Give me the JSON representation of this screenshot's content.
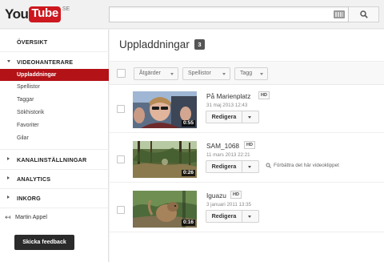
{
  "header": {
    "logo_you": "You",
    "logo_tube": "Tube",
    "logo_region": "SE",
    "search": {
      "value": "",
      "placeholder": ""
    }
  },
  "sidebar": {
    "overview": "ÖVERSIKT",
    "video_manager": "VIDEOHANTERARE",
    "sub_items": [
      "Uppladdningar",
      "Spellistor",
      "Taggar",
      "Sökhistorik",
      "Favoriter",
      "Gilar"
    ],
    "active_item": "Uppladdningar",
    "channel_settings": "KANALINSTÄLLNINGAR",
    "analytics": "ANALYTICS",
    "inbox": "INKORG",
    "user_name": "Martin Appel",
    "feedback_button": "Skicka feedback"
  },
  "main": {
    "title": "Uppladdningar",
    "count": "3",
    "toolbar": {
      "actions": "Åtgärder",
      "playlists": "Spellistor",
      "tags": "Tagg"
    },
    "videos": [
      {
        "title": "På Marienplatz",
        "hd": "HD",
        "date": "31 maj 2013 12:43",
        "duration": "0:55",
        "edit_label": "Redigera",
        "tip": ""
      },
      {
        "title": "SAM_1068",
        "hd": "HD",
        "date": "11 mars 2013 22:21",
        "duration": "0:26",
        "edit_label": "Redigera",
        "tip": "Förbättra det här videoklippet"
      },
      {
        "title": "Iguazu",
        "hd": "HD",
        "date": "3 januari 2011 13:35",
        "duration": "0:16",
        "edit_label": "Redigera",
        "tip": ""
      }
    ]
  },
  "colors": {
    "brand_red": "#cc181e",
    "active_sidebar": "#b31217"
  }
}
